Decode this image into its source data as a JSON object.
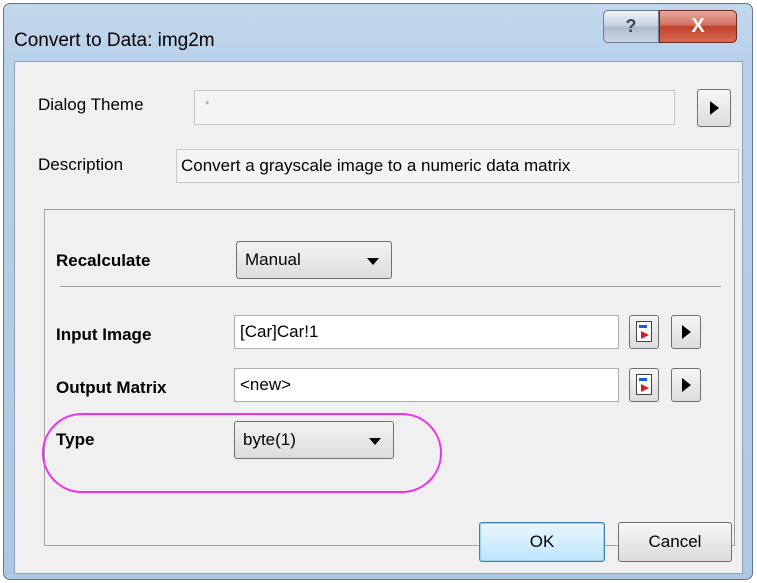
{
  "window": {
    "title": "Convert to Data: img2m",
    "help_glyph": "?",
    "close_glyph": "X"
  },
  "theme": {
    "label": "Dialog Theme",
    "value": "*"
  },
  "description": {
    "label": "Description",
    "value": "Convert a grayscale image to a numeric data matrix"
  },
  "recalculate": {
    "label": "Recalculate",
    "value": "Manual"
  },
  "input_image": {
    "label": "Input Image",
    "value": "[Car]Car!1"
  },
  "output_matrix": {
    "label": "Output Matrix",
    "value": "<new>"
  },
  "type": {
    "label": "Type",
    "value": "byte(1)"
  },
  "buttons": {
    "ok": "OK",
    "cancel": "Cancel"
  },
  "colors": {
    "highlight": "#ee30ee",
    "frame": "#b9d1ea",
    "close": "#c0412e"
  },
  "icons": [
    "help-icon",
    "close-icon",
    "arrow-right-icon",
    "dropdown-arrow-icon",
    "pick-object-icon"
  ]
}
